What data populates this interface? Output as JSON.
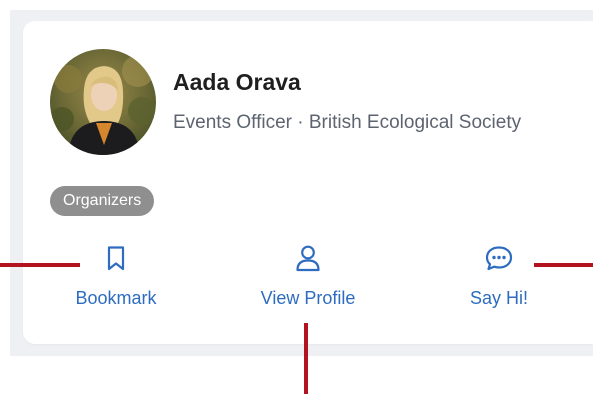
{
  "profile": {
    "name": "Aada Orava",
    "subtitle": "Events Officer · British Ecological Society",
    "tag": "Organizers"
  },
  "actions": {
    "bookmark": {
      "label": "Bookmark",
      "icon": "bookmark-icon"
    },
    "view_profile": {
      "label": "View Profile",
      "icon": "user-icon"
    },
    "say_hi": {
      "label": "Say Hi!",
      "icon": "chat-bubble-icon"
    }
  },
  "colors": {
    "accent": "#2d6cc0",
    "tag_bg": "#8f8f8f",
    "marker": "#b3121f",
    "backdrop": "#eef0f4"
  }
}
